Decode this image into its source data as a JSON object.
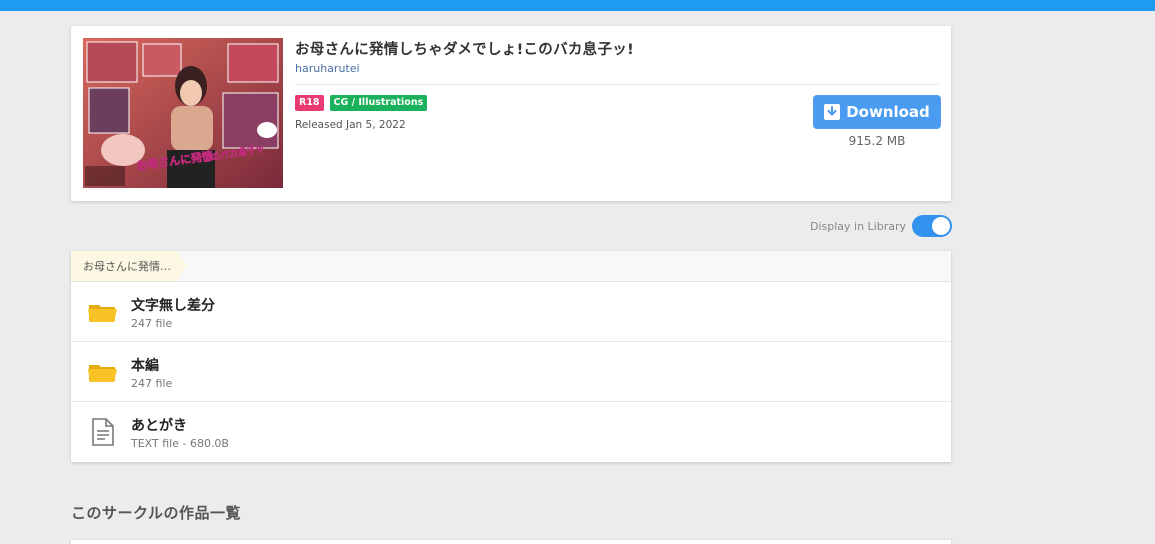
{
  "work": {
    "title": "お母さんに発情しちゃダメでしょ!このバカ息子ッ!",
    "circle": "haruharutei",
    "tags": [
      {
        "label": "R18",
        "color": "#ea3a72"
      },
      {
        "label": "CG / Illustrations",
        "color": "#19b15b"
      }
    ],
    "released": "Released Jan 5, 2022",
    "download_label": "Download",
    "file_size": "915.2 MB",
    "thumbnail_icon": "work-cover-image"
  },
  "library": {
    "display_label": "Display in Library",
    "display_on": true
  },
  "files": {
    "breadcrumb": "お母さんに発情…",
    "items": [
      {
        "name": "文字無し差分",
        "meta": "247 file",
        "icon": "folder-icon"
      },
      {
        "name": "本編",
        "meta": "247 file",
        "icon": "folder-icon"
      },
      {
        "name": "あとがき",
        "meta": "TEXT file - 680.0B",
        "icon": "text-file-icon"
      }
    ]
  },
  "circle_works": {
    "title": "このサークルの作品一覧"
  },
  "colors": {
    "topbar": "#1e9bf0",
    "download": "#4b9cf0",
    "toggle_on": "#3392ee",
    "folder": "#f7c325"
  }
}
